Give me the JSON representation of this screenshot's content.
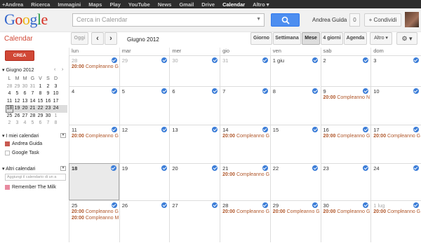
{
  "gbar": [
    "+Andrea",
    "Ricerca",
    "Immagini",
    "Maps",
    "Play",
    "YouTube",
    "News",
    "Gmail",
    "Drive",
    "Calendar",
    "Altro ▾"
  ],
  "gbar_active": 9,
  "header": {
    "logo": [
      "G",
      "o",
      "o",
      "g",
      "l",
      "e"
    ],
    "search_placeholder": "Cerca in Calendar",
    "user": "Andrea Guida",
    "notifications": "0",
    "share": "+ Condividi"
  },
  "toolbar": {
    "app_title": "Calendar",
    "today": "Oggi",
    "prev": "‹",
    "next": "›",
    "date": "Giugno 2012",
    "views": [
      "Giorno",
      "Settimana",
      "Mese",
      "4 giorni",
      "Agenda"
    ],
    "active_view": 2,
    "more": "Altro ▾",
    "settings": "⚙ ▾"
  },
  "sidebar": {
    "create": "CREA",
    "mini_title": "Giugno 2012",
    "mini_prev": "‹",
    "mini_next": "›",
    "mini_days": [
      "L",
      "M",
      "M",
      "G",
      "V",
      "S",
      "D"
    ],
    "mini_weeks": [
      [
        "28",
        "29",
        "30",
        "31",
        "1",
        "2",
        "3"
      ],
      [
        "4",
        "5",
        "6",
        "7",
        "8",
        "9",
        "10"
      ],
      [
        "11",
        "12",
        "13",
        "14",
        "15",
        "16",
        "17"
      ],
      [
        "18",
        "19",
        "20",
        "21",
        "22",
        "23",
        "24"
      ],
      [
        "25",
        "26",
        "27",
        "28",
        "29",
        "30",
        "1"
      ],
      [
        "2",
        "3",
        "4",
        "5",
        "6",
        "7",
        "8"
      ]
    ],
    "my_cals_title": "I miei calendari",
    "my_cals": [
      {
        "name": "Andrea Guida",
        "color": "#c85a50"
      },
      {
        "name": "Google Task",
        "color": "#ffffff"
      }
    ],
    "other_cals_title": "Altri calendari",
    "add_placeholder": "Aggiungi il calendario di un a",
    "other_cals": [
      {
        "name": "Remember The Milk",
        "color": "#e88aa0"
      }
    ]
  },
  "grid": {
    "days": [
      "lun",
      "mar",
      "mer",
      "gio",
      "ven",
      "sab",
      "dom"
    ],
    "weeks": [
      [
        {
          "n": "28",
          "dim": true,
          "ev": [
            "20:00 Compleanno G"
          ]
        },
        {
          "n": "29",
          "dim": true
        },
        {
          "n": "30",
          "dim": true
        },
        {
          "n": "31",
          "dim": true
        },
        {
          "n": "1 giu"
        },
        {
          "n": "2"
        },
        {
          "n": "3"
        }
      ],
      [
        {
          "n": "4"
        },
        {
          "n": "5"
        },
        {
          "n": "6"
        },
        {
          "n": "7"
        },
        {
          "n": "8"
        },
        {
          "n": "9",
          "ev": [
            "20:00 Compleanno N"
          ]
        },
        {
          "n": "10"
        }
      ],
      [
        {
          "n": "11",
          "ev": [
            "20:00 Compleanno G"
          ]
        },
        {
          "n": "12"
        },
        {
          "n": "13"
        },
        {
          "n": "14",
          "ev": [
            "20:00 Compleanno G"
          ]
        },
        {
          "n": "15"
        },
        {
          "n": "16",
          "ev": [
            "20:00 Compleanno G"
          ]
        },
        {
          "n": "17",
          "ev": [
            "20:00 Compleanno G"
          ]
        }
      ],
      [
        {
          "n": "18",
          "today": true
        },
        {
          "n": "19"
        },
        {
          "n": "20"
        },
        {
          "n": "21",
          "ev": [
            "20:00 Compleanno G"
          ]
        },
        {
          "n": "22"
        },
        {
          "n": "23"
        },
        {
          "n": "24"
        }
      ],
      [
        {
          "n": "25",
          "ev": [
            "20:00 Compleanno G",
            "20:00 Compleanno M"
          ]
        },
        {
          "n": "26"
        },
        {
          "n": "27"
        },
        {
          "n": "28",
          "ev": [
            "20:00 Compleanno G"
          ]
        },
        {
          "n": "29",
          "ev": [
            "20:00 Compleanno G"
          ]
        },
        {
          "n": "30",
          "ev": [
            "20:00 Compleanno G"
          ]
        },
        {
          "n": "1 lug",
          "dim": true,
          "ev": [
            "20:00 Compleanno G"
          ]
        }
      ]
    ]
  }
}
